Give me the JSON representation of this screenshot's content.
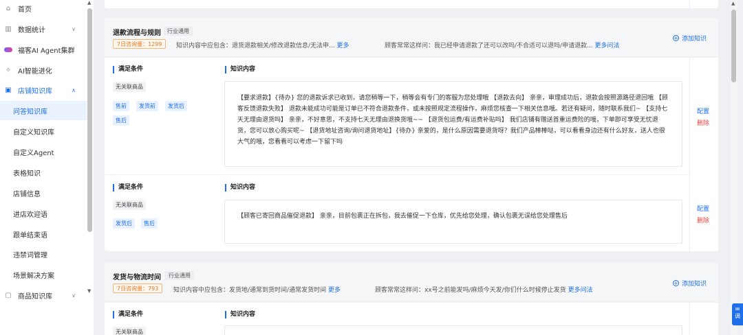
{
  "sidebar": {
    "items": [
      {
        "label": "首页",
        "icon": "home-icon"
      },
      {
        "label": "数据统计",
        "icon": "chart-icon"
      },
      {
        "label": "福客AI Agent集群",
        "icon": "brand-icon"
      },
      {
        "label": "AI智能进化",
        "icon": "sparkle-icon"
      },
      {
        "label": "店铺知识库",
        "icon": "book-icon"
      },
      {
        "label": "问答知识库"
      },
      {
        "label": "自定义知识库"
      },
      {
        "label": "自定义Agent"
      },
      {
        "label": "表格知识"
      },
      {
        "label": "店铺信息"
      },
      {
        "label": "进店欢迎语"
      },
      {
        "label": "跟单结束语"
      },
      {
        "label": "违禁词管理"
      },
      {
        "label": "场景解决方案"
      },
      {
        "label": "商品知识库",
        "icon": "box-icon"
      }
    ]
  },
  "section1": {
    "title": "退款流程与规则",
    "tag": "行业通用",
    "count_badge": "7日咨询量：1299",
    "knowledge_prefix": "知识内容中应包含：退货退款相关/修改退款信息/无法申...",
    "more": "更多",
    "ask_prefix": "顾客常常这样问：我已经申请退款了还可以改吗/不合适可以退吗/申请退款...",
    "more_asks": "更多问法",
    "add_label": "添加知识",
    "rows": [
      {
        "cond_title": "满足条件",
        "no_product": "无关联商品",
        "chips": [
          "售前",
          "发货前",
          "发货后",
          "售后"
        ],
        "content_title": "知识内容",
        "content": "【要求退款】{待办} 您的退款诉求已收到，请您稍等一下，稍等会有专门的客服为您处理哦 【退款去向】 亲亲，审理成功后，退款会按照源路径退回哦 【顾客反馈退款失败】 退款未能成功可能是订单已不符合退款条件，或未按照规定流程操作，麻烦您核查一下相关信息哦。若还有疑问，随时联系我们~ 【支持七天无理由退货吗】 亲亲，不好意思，不支持七天无理由退换货哦~~ 【退货包运费/有运费补贴吗】 我们店铺有赠送首重运费险的哦，下单即可享受无忧退货，您可以放心购买呢~ 【退货地址咨询/询问退货地址】{待办} 亲爱的，是什么原因需要退货呀？我们产品棒棒哒，可以看看身边还有什么好友，送人也很大气的哦，您看看可以考虑一下留下吗",
        "config": "配置",
        "delete": "删除"
      },
      {
        "cond_title": "满足条件",
        "no_product": "无关联商品",
        "chips": [
          "发货后",
          "售后"
        ],
        "content_title": "知识内容",
        "content": "【顾客已寄回商品催促退款】 亲亲，目前包裹正在拆包，我去催促一下仓库，优先给您处理，确认包裹无误给您处理售后",
        "config": "配置",
        "delete": "删除"
      }
    ]
  },
  "section2": {
    "title": "发货与物流时间",
    "tag": "行业通用",
    "count_badge": "7日咨询量：793",
    "knowledge_prefix": "知识内容中应包含：发货地/通常到货时间/通常发货时间",
    "more": "更多",
    "ask_prefix": "顾客常常这样问：xx号之前能发吗/麻烦今天发/你们什么时候停止发货",
    "more_asks": "更多问法",
    "add_label": "添加知识",
    "cond_title": "满足条件",
    "no_product": "无关联商品",
    "content_title": "知识内容"
  },
  "float_button": "调"
}
